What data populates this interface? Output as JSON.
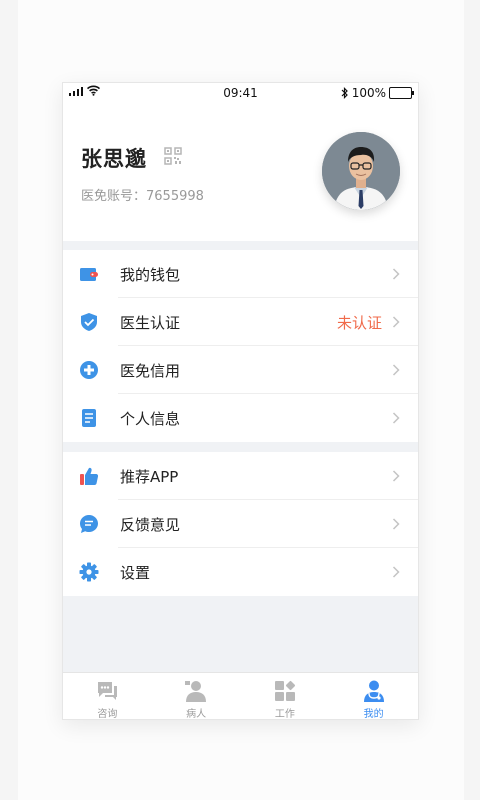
{
  "status_bar": {
    "time": "09:41",
    "battery": "100%"
  },
  "profile": {
    "name": "张思邈",
    "account_label": "医免账号：",
    "account_number": "7655998"
  },
  "menu_groups": [
    [
      {
        "label": "我的钱包",
        "icon": "wallet-icon",
        "status": ""
      },
      {
        "label": "医生认证",
        "icon": "shield-check-icon",
        "status": "未认证"
      },
      {
        "label": "医免信用",
        "icon": "plus-circle-icon",
        "status": ""
      },
      {
        "label": "个人信息",
        "icon": "document-icon",
        "status": ""
      }
    ],
    [
      {
        "label": "推荐APP",
        "icon": "thumbs-up-icon",
        "status": ""
      },
      {
        "label": "反馈意见",
        "icon": "chat-bubble-icon",
        "status": ""
      },
      {
        "label": "设置",
        "icon": "gear-icon",
        "status": ""
      }
    ]
  ],
  "tabs": [
    {
      "label": "咨询",
      "icon": "chat-icon",
      "active": false
    },
    {
      "label": "病人",
      "icon": "patient-icon",
      "active": false
    },
    {
      "label": "工作",
      "icon": "grid-icon",
      "active": false
    },
    {
      "label": "我的",
      "icon": "doctor-icon",
      "active": true
    }
  ],
  "colors": {
    "accent": "#3c8df0",
    "warning": "#f06a4a",
    "icon_blue": "#3e93e6",
    "icon_red": "#ef5350",
    "tab_inactive": "#9a9a9a"
  }
}
